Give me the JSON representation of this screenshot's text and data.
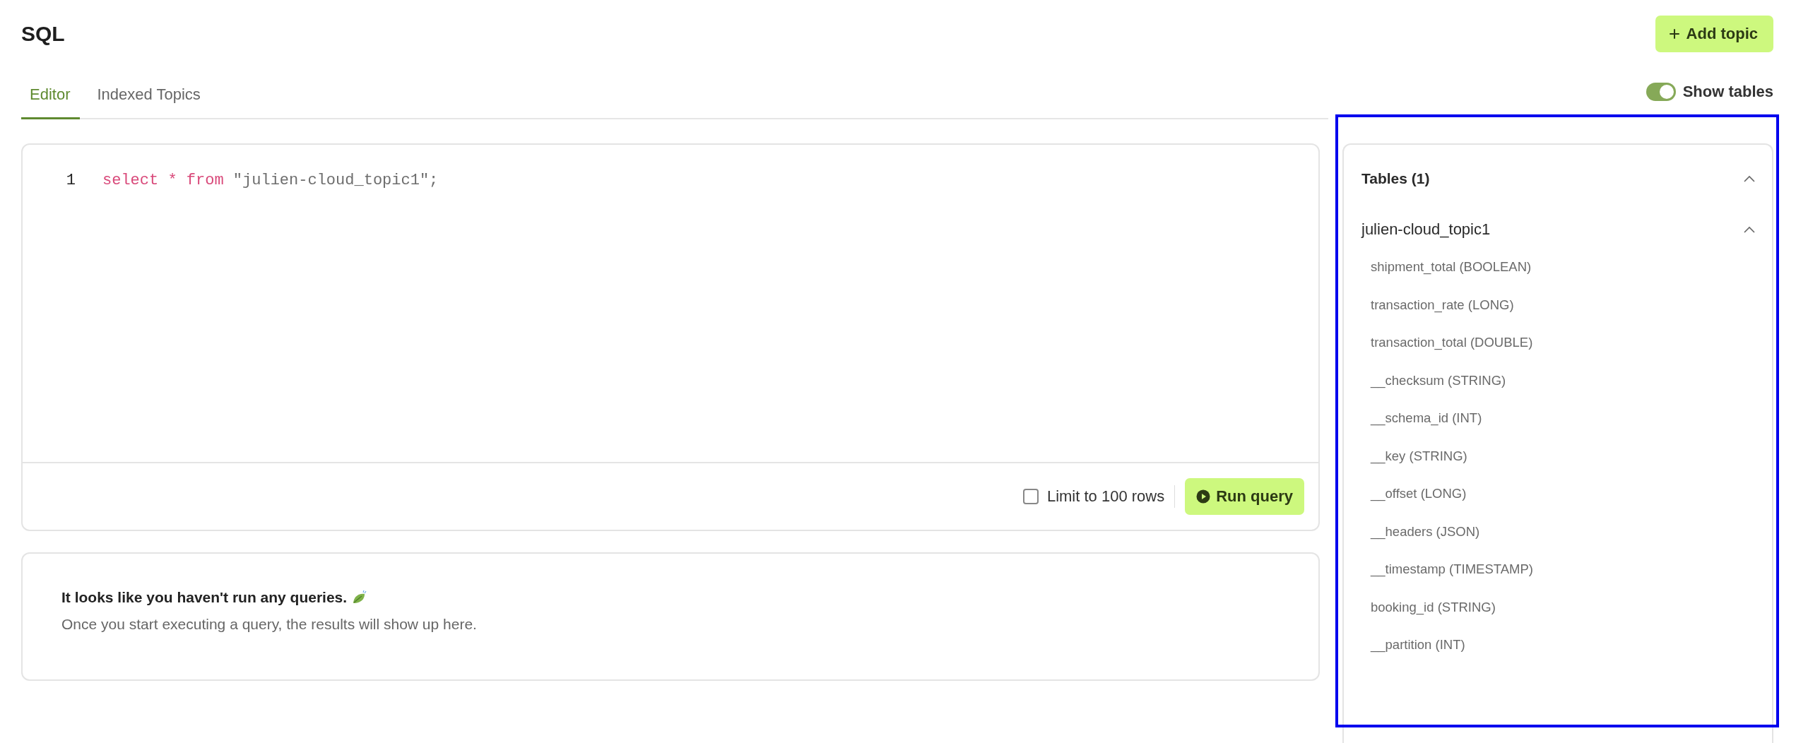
{
  "page": {
    "title": "SQL",
    "add_button": "Add topic"
  },
  "tabs": [
    {
      "label": "Editor",
      "selected": true
    },
    {
      "label": "Indexed Topics",
      "selected": false
    }
  ],
  "show_tables": {
    "label": "Show tables",
    "on": true
  },
  "editor": {
    "lines": [
      {
        "number": "1",
        "tokens": [
          {
            "text": "select * from",
            "kind": "keyword"
          },
          {
            "text": " \"julien-cloud_topic1\";",
            "kind": "string"
          }
        ]
      }
    ],
    "limit": {
      "label": "Limit to 100 rows",
      "checked": false
    },
    "run_button": "Run query"
  },
  "results": {
    "heading": "It looks like you haven't run any queries.",
    "message": "Once you start executing a query, the results will show up here."
  },
  "tables_panel": {
    "highlighted": true,
    "title": "Tables (1)",
    "expanded": true,
    "tables": [
      {
        "name": "julien-cloud_topic1",
        "expanded": true,
        "columns": [
          "shipment_total (BOOLEAN)",
          "transaction_rate (LONG)",
          "transaction_total (DOUBLE)",
          "__checksum (STRING)",
          "__schema_id (INT)",
          "__key (STRING)",
          "__offset (LONG)",
          "__headers (JSON)",
          "__timestamp (TIMESTAMP)",
          "booking_id (STRING)",
          "__partition (INT)"
        ]
      }
    ]
  }
}
